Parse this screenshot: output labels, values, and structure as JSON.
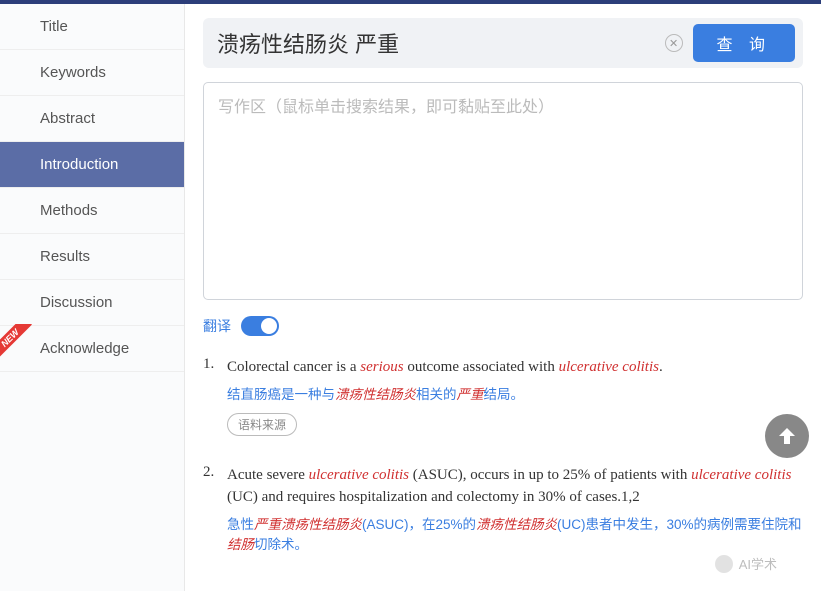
{
  "sidebar": {
    "items": [
      {
        "label": "Title"
      },
      {
        "label": "Keywords"
      },
      {
        "label": "Abstract"
      },
      {
        "label": "Introduction"
      },
      {
        "label": "Methods"
      },
      {
        "label": "Results"
      },
      {
        "label": "Discussion"
      },
      {
        "label": "Acknowledge"
      }
    ],
    "new_badge": "NEW"
  },
  "search": {
    "value": "溃疡性结肠炎 严重",
    "query_label": "查 询"
  },
  "textarea": {
    "placeholder": "写作区（鼠标单击搜索结果，即可黏贴至此处）"
  },
  "translate": {
    "label": "翻译"
  },
  "results": [
    {
      "num": "1.",
      "en_segments": [
        {
          "t": "Colorectal cancer is a ",
          "h": false
        },
        {
          "t": "serious",
          "h": true
        },
        {
          "t": " outcome associated with ",
          "h": false
        },
        {
          "t": "ulcerative colitis",
          "h": true
        },
        {
          "t": ".",
          "h": false
        }
      ],
      "zh_segments": [
        {
          "t": "结直肠癌是一种与",
          "h": false
        },
        {
          "t": "溃疡性结肠炎",
          "h": true
        },
        {
          "t": "相关的",
          "h": false
        },
        {
          "t": "严重",
          "h": true
        },
        {
          "t": "结局。",
          "h": false
        }
      ],
      "source_label": "语料来源"
    },
    {
      "num": "2.",
      "en_segments": [
        {
          "t": "Acute severe ",
          "h": false
        },
        {
          "t": "ulcerative colitis",
          "h": true
        },
        {
          "t": " (ASUC), occurs in up to 25% of patients with ",
          "h": false
        },
        {
          "t": "ulcerative colitis",
          "h": true
        },
        {
          "t": " (UC) and requires hospitalization and colectomy in 30% of cases.1,2",
          "h": false
        }
      ],
      "zh_segments": [
        {
          "t": "急性",
          "h": false
        },
        {
          "t": "严重溃疡性结肠炎",
          "h": true
        },
        {
          "t": "(ASUC)，在25%的",
          "h": false
        },
        {
          "t": "溃疡性结肠炎",
          "h": true
        },
        {
          "t": "(UC)患者中发生，30%的病例需要住院和",
          "h": false
        },
        {
          "t": "结肠",
          "h": true
        },
        {
          "t": "切除术。",
          "h": false
        }
      ]
    }
  ],
  "watermark": "AI学术"
}
